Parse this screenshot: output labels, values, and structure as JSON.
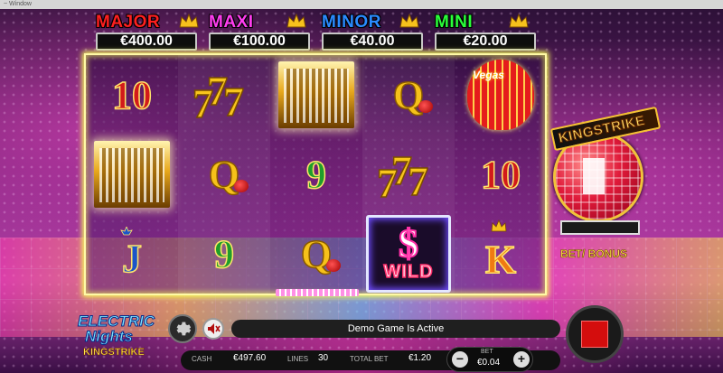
{
  "top_bar": {
    "text": "~ Window"
  },
  "jackpots": [
    {
      "name": "MAJOR",
      "value": "€400.00",
      "color": "#ff1f1f"
    },
    {
      "name": "MAXI",
      "value": "€100.00",
      "color": "#ff3df0"
    },
    {
      "name": "MINOR",
      "value": "€40.00",
      "color": "#2a8bff"
    },
    {
      "name": "MINI",
      "value": "€20.00",
      "color": "#2aff3a"
    }
  ],
  "reels": [
    [
      "10",
      "building",
      "J"
    ],
    [
      "seven",
      "Q",
      "9"
    ],
    [
      "building",
      "9",
      "Q"
    ],
    [
      "Q",
      "seven",
      "WILD"
    ],
    [
      "balloon",
      "10",
      "K"
    ]
  ],
  "symbols": {
    "balloon_label": "Vegas",
    "wild_symbol": "$",
    "wild_label": "WILD"
  },
  "kingstrike": {
    "title": "KINGSTRIKE",
    "bet_bonus": "BET/ BONUS"
  },
  "logo": {
    "line1": "ELECTRIC",
    "line2": "Nights",
    "line3": "KINGSTRIKE"
  },
  "message": "Demo Game Is Active",
  "footer": {
    "cash_label": "CASH",
    "cash_value": "€497.60",
    "lines_label": "LINES",
    "lines_value": "30",
    "total_bet_label": "TOTAL BET",
    "total_bet_value": "€1.20",
    "bet_label": "BET",
    "bet_value": "€0.04",
    "minus": "−",
    "plus": "+"
  }
}
